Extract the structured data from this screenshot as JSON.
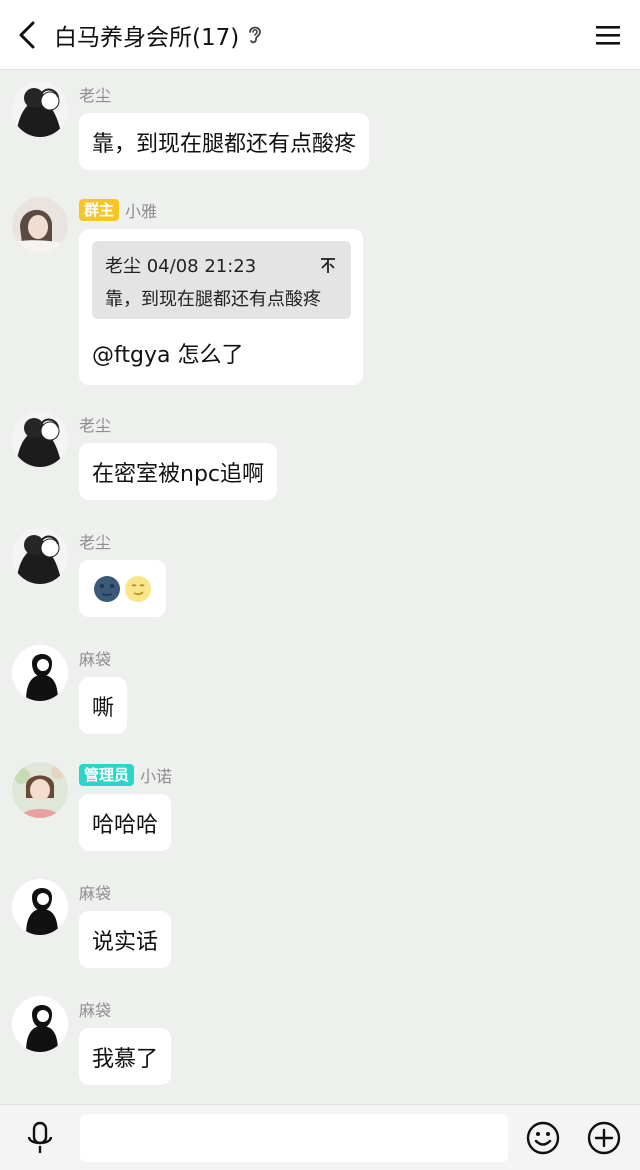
{
  "header": {
    "title": "白马养身会所(17)",
    "back_icon": "chevron-left-icon",
    "ear_icon": "ear-icon",
    "menu_icon": "hamburger-menu-icon"
  },
  "badges": {
    "owner": "群主",
    "admin": "管理员"
  },
  "messages": [
    {
      "sender": "老尘",
      "text": "靠，到现在腿都还有点酸疼"
    },
    {
      "sender": "小雅",
      "badge": "群主",
      "quote": {
        "author_time": "老尘 04/08 21:23",
        "text": "靠，到现在腿都还有点酸疼"
      },
      "text": "@ftgya 怎么了"
    },
    {
      "sender": "老尘",
      "text": "在密室被npc追啊"
    },
    {
      "sender": "老尘",
      "emojis": [
        "new-moon-face",
        "first-quarter-moon-face"
      ]
    },
    {
      "sender": "麻袋",
      "text": "嘶"
    },
    {
      "sender": "小诺",
      "badge": "管理员",
      "text": "哈哈哈"
    },
    {
      "sender": "麻袋",
      "text": "说实话"
    },
    {
      "sender": "麻袋",
      "text": "我慕了"
    }
  ],
  "input": {
    "placeholder": "",
    "value": ""
  },
  "colors": {
    "background": "#edf0ed",
    "owner_badge": "#f7c623",
    "admin_badge": "#2ed3c9"
  }
}
